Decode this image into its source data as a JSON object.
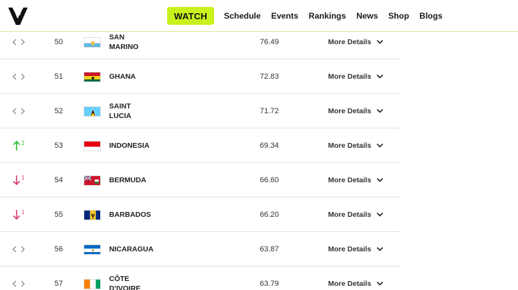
{
  "nav": {
    "watch_label": "WATCH",
    "links": [
      "Schedule",
      "Events",
      "Rankings",
      "News",
      "Shop",
      "Blogs"
    ]
  },
  "colors": {
    "accent": "#c8f21d",
    "up": "#2eb82e",
    "down": "#d63a6a",
    "neutral": "#8a8a8a"
  },
  "rows": [
    {
      "trend": "same",
      "change": "",
      "rank": "50",
      "flag": "san-marino-flag",
      "country": "SAN MARINO",
      "points": "76.49",
      "details_label": "More Details"
    },
    {
      "trend": "same",
      "change": "",
      "rank": "51",
      "flag": "ghana-flag",
      "country": "GHANA",
      "points": "72.83",
      "details_label": "More Details"
    },
    {
      "trend": "same",
      "change": "",
      "rank": "52",
      "flag": "saint-lucia-flag",
      "country": "SAINT LUCIA",
      "points": "71.72",
      "details_label": "More Details"
    },
    {
      "trend": "up",
      "change": "2",
      "rank": "53",
      "flag": "indonesia-flag",
      "country": "INDONESIA",
      "points": "69.34",
      "details_label": "More Details"
    },
    {
      "trend": "down",
      "change": "1",
      "rank": "54",
      "flag": "bermuda-flag",
      "country": "BERMUDA",
      "points": "66.60",
      "details_label": "More Details"
    },
    {
      "trend": "down",
      "change": "1",
      "rank": "55",
      "flag": "barbados-flag",
      "country": "BARBADOS",
      "points": "66.20",
      "details_label": "More Details"
    },
    {
      "trend": "same",
      "change": "",
      "rank": "56",
      "flag": "nicaragua-flag",
      "country": "NICARAGUA",
      "points": "63.87",
      "details_label": "More Details"
    },
    {
      "trend": "same",
      "change": "",
      "rank": "57",
      "flag": "cote-divoire-flag",
      "country": "CÔTE D'IVOIRE",
      "points": "63.79",
      "details_label": "More Details"
    }
  ]
}
